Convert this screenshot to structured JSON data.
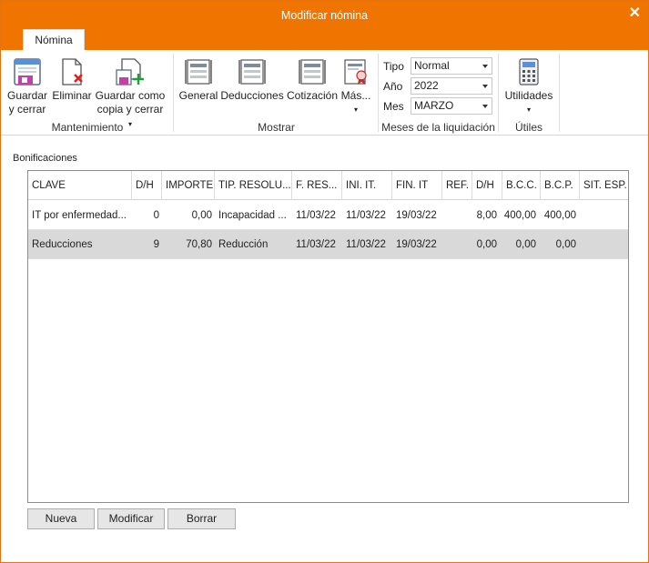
{
  "window": {
    "title": "Modificar nómina",
    "close_glyph": "✕"
  },
  "tab": {
    "label": "Nómina"
  },
  "ribbon": {
    "mantenimiento": {
      "label": "Mantenimiento",
      "guardar": [
        "Guardar",
        "y cerrar"
      ],
      "eliminar": "Eliminar",
      "guardar_copia": [
        "Guardar como",
        "copia y cerrar"
      ]
    },
    "mostrar": {
      "label": "Mostrar",
      "general": "General",
      "deducciones": "Deducciones",
      "cotizacion": "Cotización",
      "mas": "Más..."
    },
    "meses": {
      "label": "Meses de la liquidación",
      "tipo_label": "Tipo",
      "tipo_value": "Normal",
      "anio_label": "Año",
      "anio_value": "2022",
      "mes_label": "Mes",
      "mes_value": "MARZO"
    },
    "utiles": {
      "label": "Útiles",
      "utilidades": "Utilidades"
    }
  },
  "section": {
    "title": "Bonificaciones"
  },
  "table": {
    "headers": [
      "CLAVE",
      "D/H",
      "IMPORTE",
      "TIP. RESOLU...",
      "F. RES...",
      "INI. IT.",
      "FIN. IT",
      "REF.",
      "D/H",
      "B.C.C.",
      "B.C.P.",
      "SIT. ESP."
    ],
    "rows": [
      [
        "IT por enfermedad...",
        "0",
        "0,00",
        "Incapacidad ...",
        "11/03/22",
        "11/03/22",
        "19/03/22",
        "",
        "8,00",
        "400,00",
        "400,00",
        ""
      ],
      [
        "Reducciones",
        "9",
        "70,80",
        "Reducción",
        "11/03/22",
        "11/03/22",
        "19/03/22",
        "",
        "0,00",
        "0,00",
        "0,00",
        ""
      ]
    ]
  },
  "buttons": {
    "nueva": "Nueva",
    "modificar": "Modificar",
    "borrar": "Borrar"
  },
  "colors": {
    "accent": "#ef7400",
    "selected_row": "#d9d9d9"
  }
}
